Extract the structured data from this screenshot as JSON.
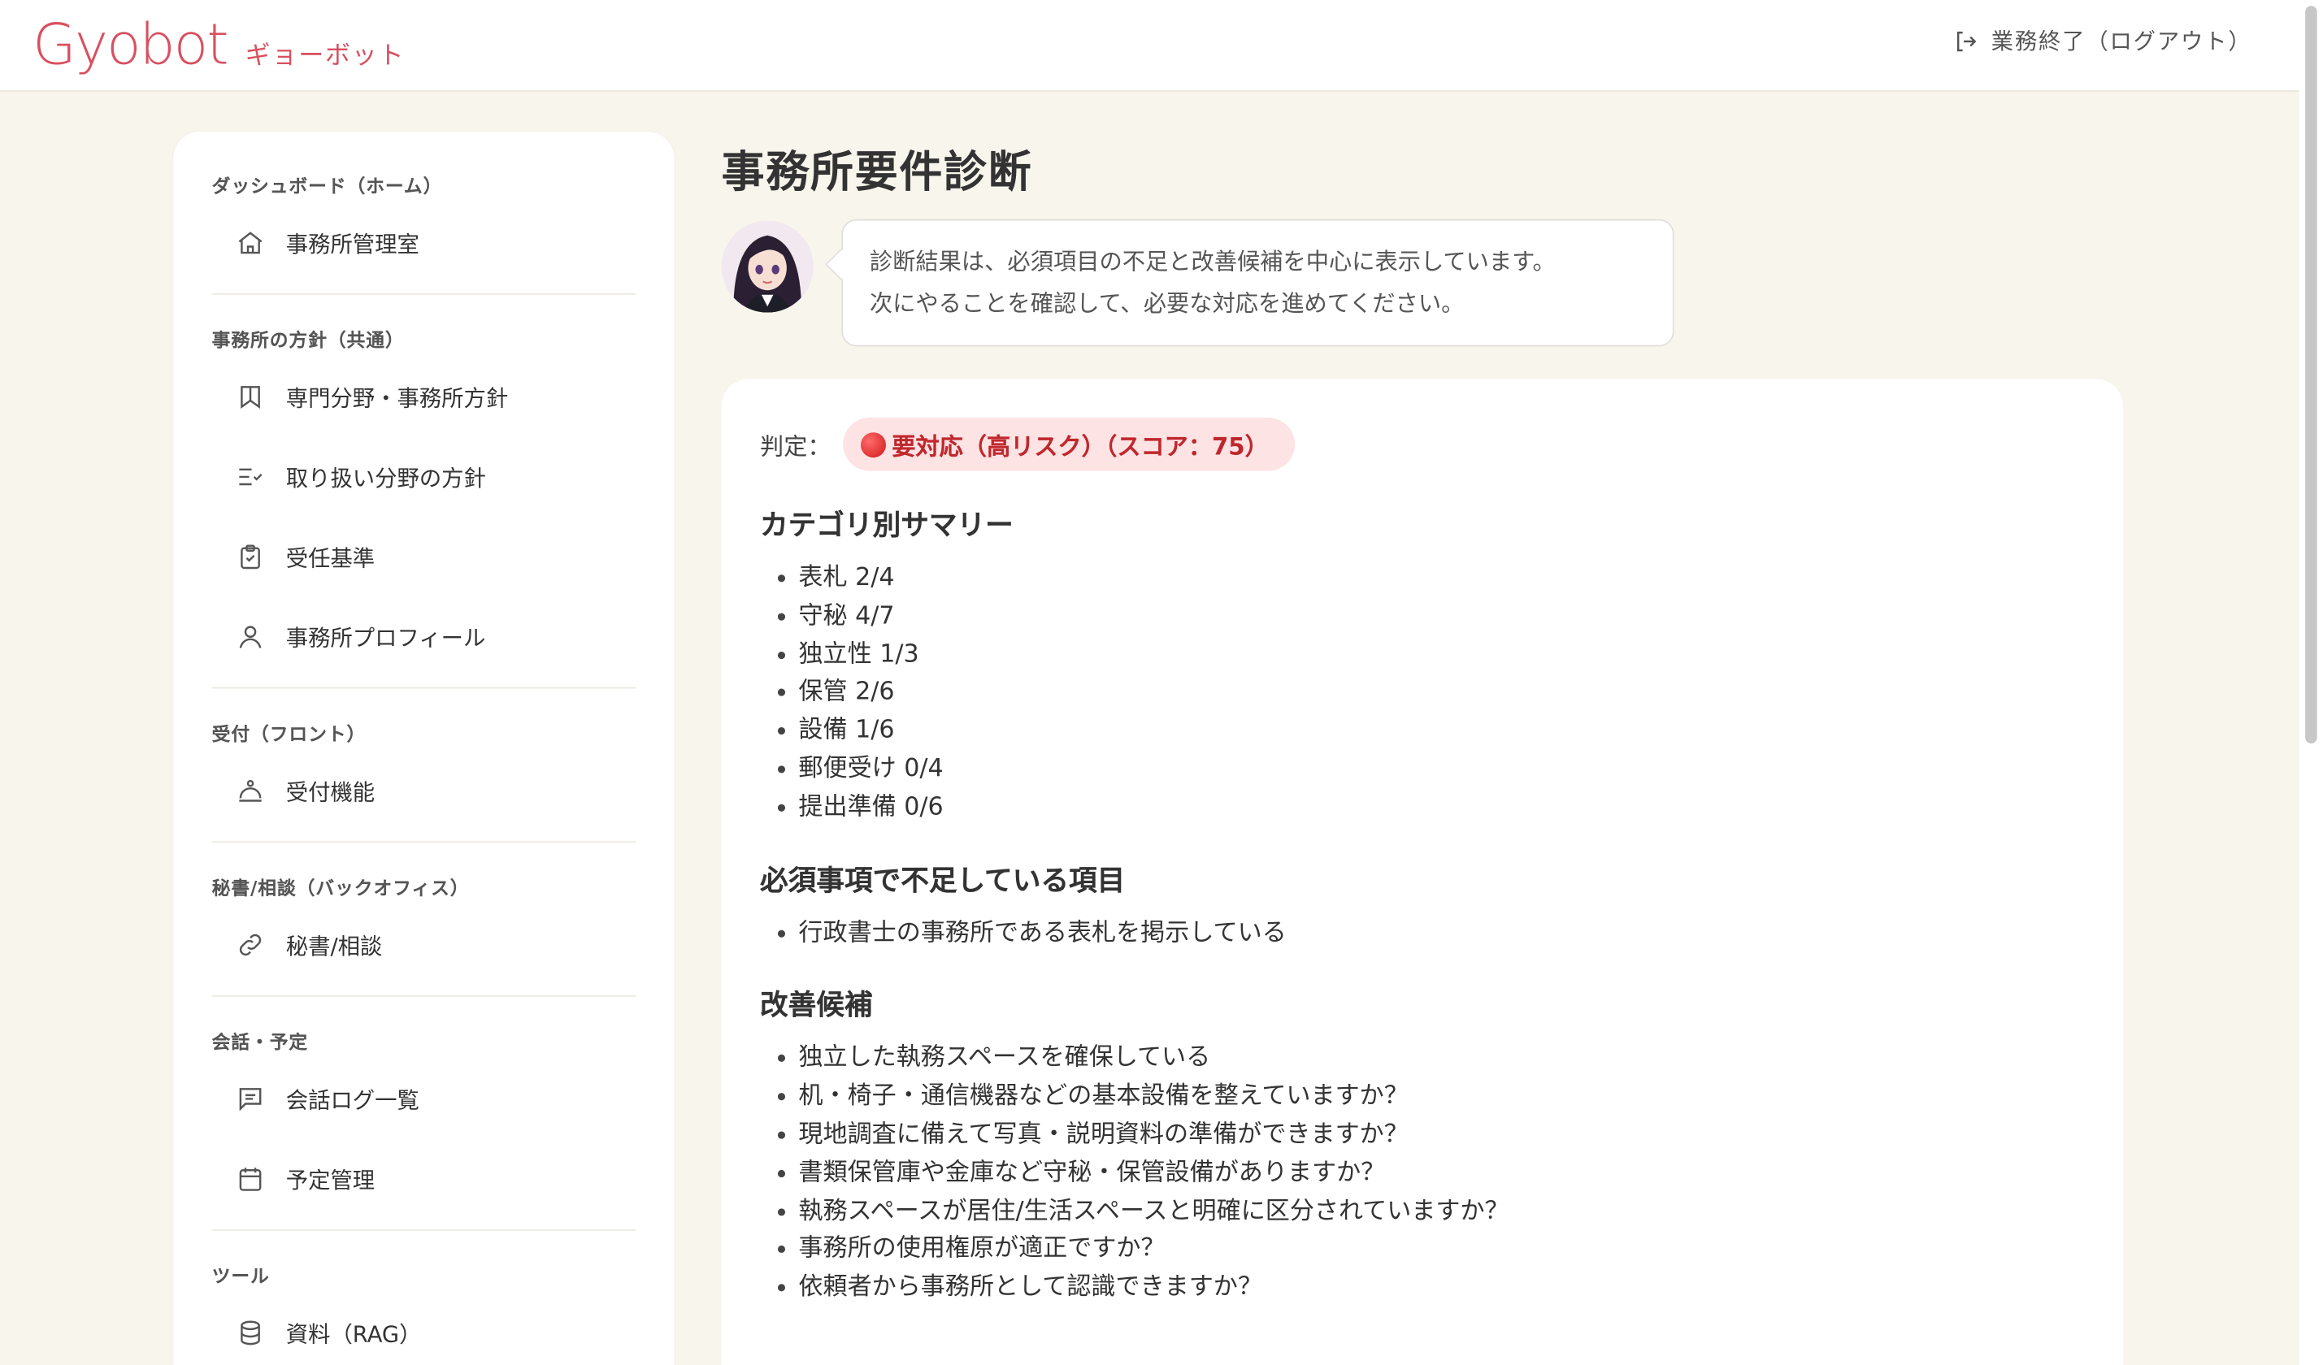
{
  "header": {
    "logo_text": "Gyobot",
    "logo_sub": "ギョーボット",
    "logout_label": "業務終了（ログアウト）"
  },
  "sidebar": {
    "sections": [
      {
        "title": "ダッシュボード（ホーム）",
        "items": [
          {
            "label": "事務所管理室",
            "icon": "home-icon"
          }
        ]
      },
      {
        "title": "事務所の方針（共通）",
        "items": [
          {
            "label": "専門分野・事務所方針",
            "icon": "bookmark-icon"
          },
          {
            "label": "取り扱い分野の方針",
            "icon": "list-check-icon"
          },
          {
            "label": "受任基準",
            "icon": "clipboard-check-icon"
          },
          {
            "label": "事務所プロフィール",
            "icon": "user-icon"
          }
        ]
      },
      {
        "title": "受付（フロント）",
        "items": [
          {
            "label": "受付機能",
            "icon": "concierge-icon"
          }
        ]
      },
      {
        "title": "秘書/相談（バックオフィス）",
        "items": [
          {
            "label": "秘書/相談",
            "icon": "link-icon"
          }
        ]
      },
      {
        "title": "会話・予定",
        "items": [
          {
            "label": "会話ログ一覧",
            "icon": "chat-icon"
          },
          {
            "label": "予定管理",
            "icon": "calendar-icon"
          }
        ]
      },
      {
        "title": "ツール",
        "items": [
          {
            "label": "資料（RAG）",
            "icon": "database-icon"
          }
        ]
      }
    ]
  },
  "main": {
    "title": "事務所要件診断",
    "bubble_line1": "診断結果は、必須項目の不足と改善候補を中心に表示しています。",
    "bubble_line2": "次にやることを確認して、必要な対応を進めてください。",
    "verdict_label": "判定：",
    "verdict_badge": "要対応（高リスク）（スコア：75）",
    "verdict_color": "#c0272d",
    "summary_title": "カテゴリ別サマリー",
    "summary_items": [
      "表札 2/4",
      "守秘 4/7",
      "独立性 1/3",
      "保管 2/6",
      "設備 1/6",
      "郵便受け 0/4",
      "提出準備 0/6"
    ],
    "missing_title": "必須事項で不足している項目",
    "missing_items": [
      "行政書士の事務所である表札を掲示している"
    ],
    "improve_title": "改善候補",
    "improve_items": [
      "独立した執務スペースを確保している",
      "机・椅子・通信機器などの基本設備を整えていますか？",
      "現地調査に備えて写真・説明資料の準備ができますか？",
      "書類保管庫や金庫など守秘・保管設備がありますか？",
      "執務スペースが居住/生活スペースと明確に区分されていますか？",
      "事務所の使用権原が適正ですか？",
      "依頼者から事務所として認識できますか？"
    ]
  },
  "colors": {
    "brand": "#d9505f",
    "background": "#f8f5ec",
    "badge_bg": "#fde3e3"
  }
}
